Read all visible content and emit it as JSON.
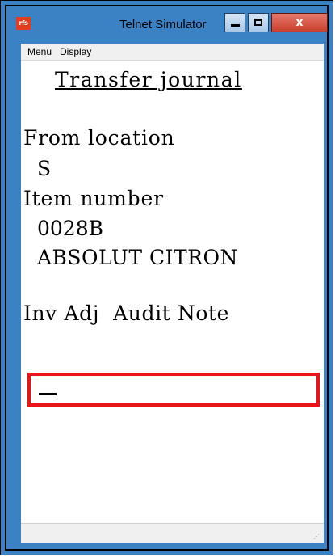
{
  "window": {
    "app_icon_text": "rfs",
    "title": "Telnet Simulator",
    "minimize_label": "",
    "maximize_label": "",
    "close_label": "x"
  },
  "menu": {
    "items": [
      {
        "label": "Menu"
      },
      {
        "label": "Display"
      }
    ]
  },
  "screen": {
    "title": "Transfer journal",
    "from_location_label": "From location",
    "from_location_value": "S",
    "item_number_label": "Item number",
    "item_number_value": "0028B",
    "item_description": "ABSOLUT CITRON",
    "options_line": "Inv Adj  Audit Note",
    "input_value": ""
  },
  "colors": {
    "titlebar": "#3a82c4",
    "input_highlight": "#e8141a",
    "app_icon_bg": "#e63c1e"
  }
}
